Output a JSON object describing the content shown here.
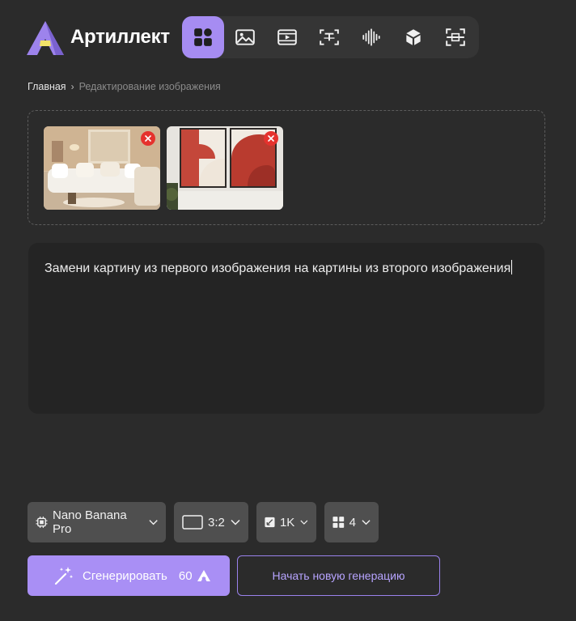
{
  "app": {
    "name": "Артиллект"
  },
  "nav": {
    "active": "apps",
    "items": [
      {
        "id": "apps",
        "icon": "apps-grid-icon"
      },
      {
        "id": "image",
        "icon": "image-icon"
      },
      {
        "id": "video",
        "icon": "video-icon"
      },
      {
        "id": "text",
        "icon": "text-icon"
      },
      {
        "id": "audio",
        "icon": "audio-wave-icon"
      },
      {
        "id": "3d",
        "icon": "cube-icon"
      },
      {
        "id": "scan",
        "icon": "scan-icon"
      }
    ]
  },
  "breadcrumb": {
    "home": "Главная",
    "separator": "›",
    "current": "Редактирование изображения"
  },
  "uploads": [
    {
      "subject": "beige living room with white sofa",
      "remove_icon": "close-icon"
    },
    {
      "subject": "two red abstract wall paintings",
      "remove_icon": "close-icon"
    }
  ],
  "prompt": {
    "value": "Замени картину из первого изображения на картины из второго изображения"
  },
  "settings": {
    "model": {
      "icon": "chip-icon",
      "value": "Nano Banana Pro"
    },
    "aspect": {
      "icon": "aspect-ratio-icon",
      "value": "3:2"
    },
    "resolution": {
      "icon": "resize-icon",
      "value": "1K"
    },
    "count": {
      "icon": "grid-icon",
      "value": "4"
    }
  },
  "actions": {
    "generate_label": "Сгенерировать",
    "generate_cost": "60",
    "new_generation_label": "Начать новую генерацию"
  },
  "colors": {
    "accent": "#a98ff5",
    "background": "#2b2b2b",
    "remove": "#e5322d"
  }
}
